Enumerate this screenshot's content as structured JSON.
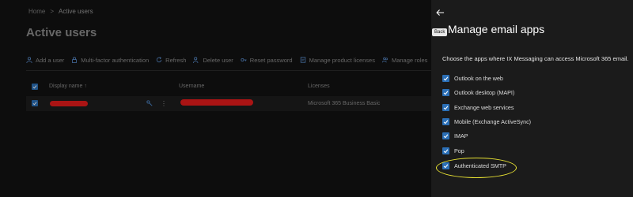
{
  "breadcrumb": {
    "home": "Home",
    "separator": ">",
    "current": "Active users"
  },
  "page": {
    "title": "Active users"
  },
  "toolbar": [
    {
      "label": "Add a user",
      "icon": "person-icon"
    },
    {
      "label": "Multi-factor authentication",
      "icon": "lock-icon"
    },
    {
      "label": "Refresh",
      "icon": "refresh-icon"
    },
    {
      "label": "Delete user",
      "icon": "person-delete-icon"
    },
    {
      "label": "Reset password",
      "icon": "key-icon"
    },
    {
      "label": "Manage product licenses",
      "icon": "license-icon"
    },
    {
      "label": "Manage roles",
      "icon": "people-icon"
    },
    {
      "label": "⋯",
      "icon": "more-icon"
    }
  ],
  "table": {
    "columns": {
      "display_name": "Display name ↑",
      "username": "Username",
      "licenses": "Licenses"
    },
    "rows": [
      {
        "licenses": "Microsoft 365 Business Basic"
      }
    ]
  },
  "panel": {
    "back_tooltip": "Back",
    "title": "Manage email apps",
    "description": "Choose the apps where IX Messaging can access Microsoft 365 email.",
    "options": [
      {
        "label": "Outlook on the web",
        "checked": true
      },
      {
        "label": "Outlook desktop (MAPI)",
        "checked": true
      },
      {
        "label": "Exchange web services",
        "checked": true
      },
      {
        "label": "Mobile (Exchange ActiveSync)",
        "checked": true
      },
      {
        "label": "IMAP",
        "checked": true
      },
      {
        "label": "Pop",
        "checked": true
      },
      {
        "label": "Authenticated SMTP",
        "checked": true
      }
    ]
  },
  "colors": {
    "accent": "#2b6fb6",
    "highlight": "#e8e233",
    "redaction": "#e31b1b"
  }
}
